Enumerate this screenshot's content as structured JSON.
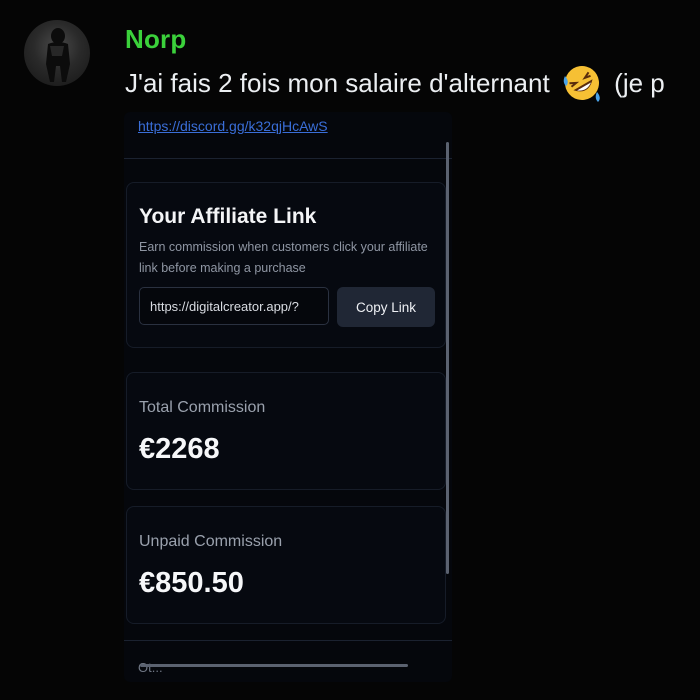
{
  "message": {
    "username": "Norp",
    "text_before_emoji": "J'ai fais 2 fois mon salaire d'alternant",
    "emoji": "rolling-on-floor-laughing-emoji",
    "text_after_emoji": "(je p",
    "username_color": "#3bd13b"
  },
  "attachment": {
    "discord_link": "https://discord.gg/k32qjHcAwS",
    "affiliate": {
      "title": "Your Affiliate Link",
      "description": "Earn commission when customers click your affiliate link before making a purchase",
      "link_value": "https://digitalcreator.app/?",
      "copy_label": "Copy Link"
    },
    "stats": [
      {
        "label": "Total Commission",
        "value": "€2268"
      },
      {
        "label": "Unpaid Commission",
        "value": "€850.50"
      }
    ],
    "partial_label": "Ot..."
  }
}
